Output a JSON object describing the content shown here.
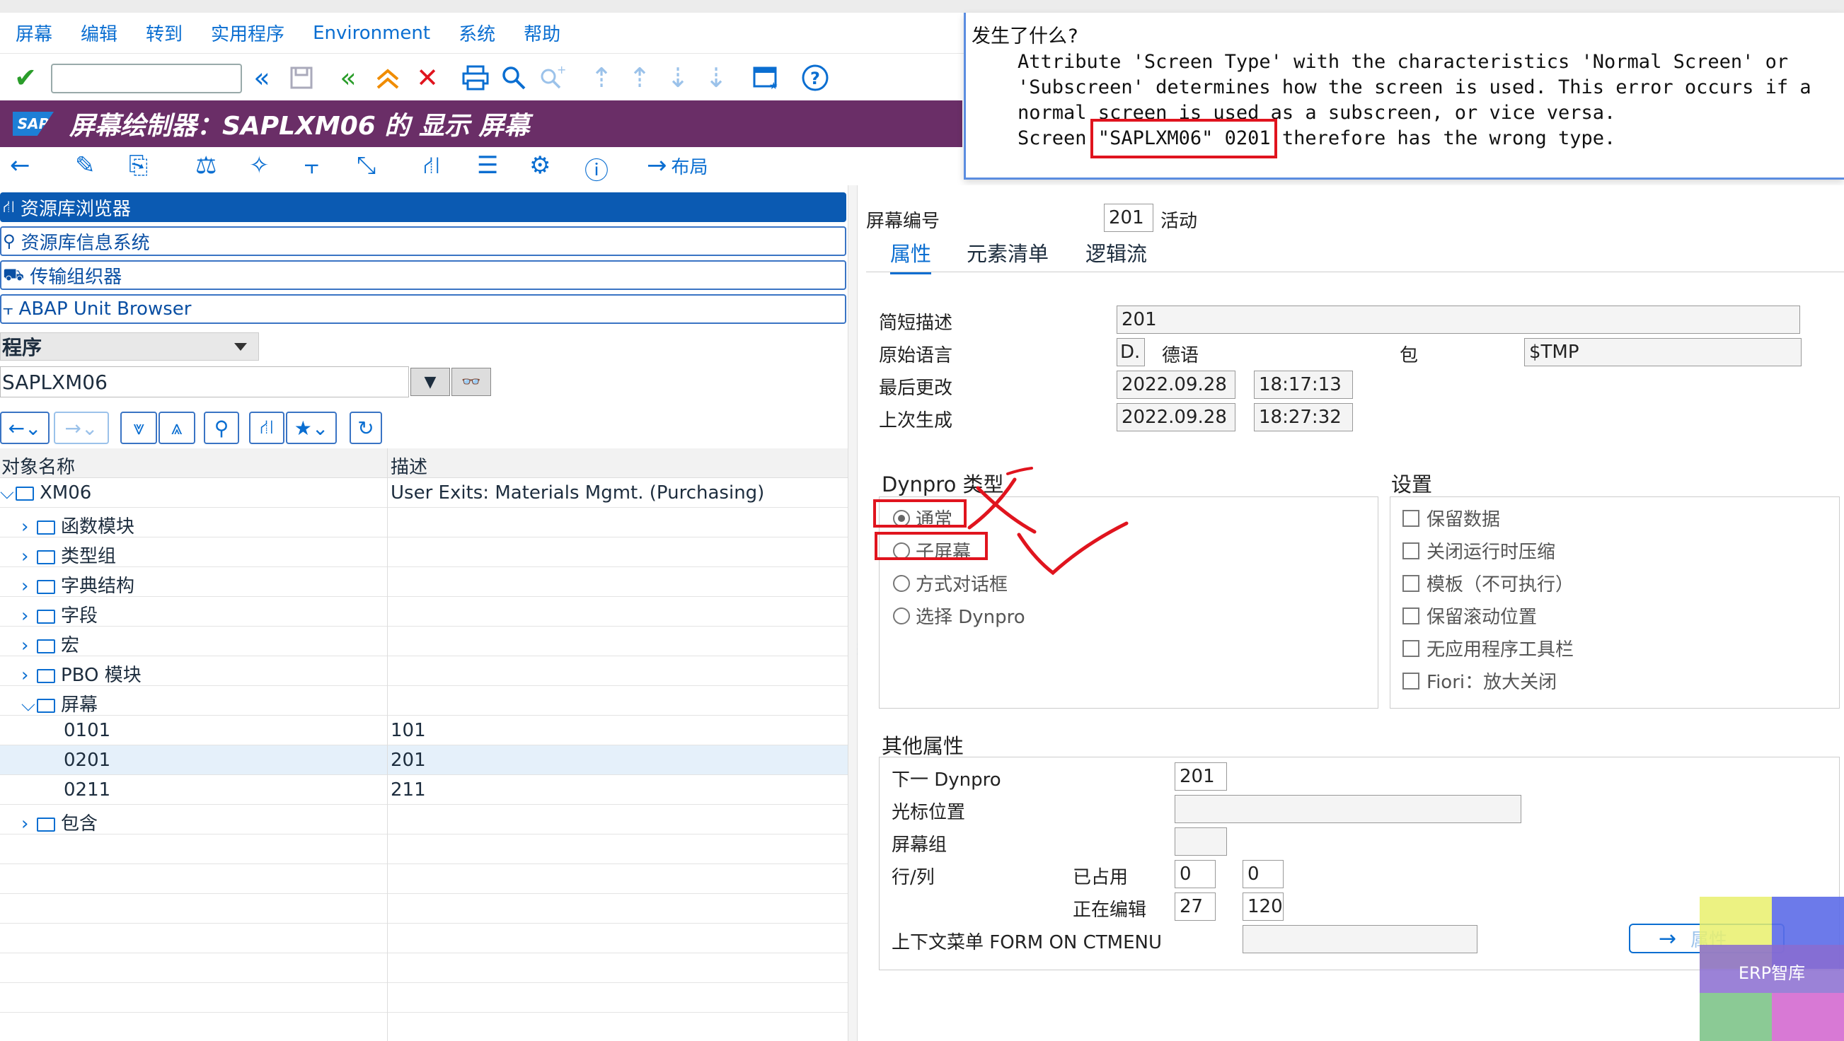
{
  "menu": [
    "屏幕",
    "编辑",
    "转到",
    "实用程序",
    "Environment",
    "系统",
    "帮助"
  ],
  "titlebar": {
    "logo": "SAP",
    "title": "屏幕绘制器：SAPLXM06 的 显示 屏幕"
  },
  "toolbar2": {
    "layout_label": "布局"
  },
  "error": {
    "heading": "发生了什么?",
    "line1": "    Attribute 'Screen Type' with the characteristics 'Normal Screen' or",
    "line2": "    'Subscreen' determines how the screen is used. This error occurs if a",
    "line3": "    normal screen is used as a subscreen, or vice versa.",
    "line4": "    Screen \"SAPLXM06\" 0201 therefore has the wrong type."
  },
  "nav": [
    "资源库浏览器",
    "资源库信息系统",
    "传输组织器",
    "ABAP Unit Browser"
  ],
  "object_type": "程序",
  "program_name": "SAPLXM06",
  "tree": {
    "col1": "对象名称",
    "col2": "描述",
    "root": {
      "name": "XM06",
      "desc": "User Exits: Materials Mgmt. (Purchasing)"
    },
    "nodes": [
      "函数模块",
      "类型组",
      "字典结构",
      "字段",
      "宏",
      "PBO 模块"
    ],
    "screens_label": "屏幕",
    "screens": [
      {
        "name": "0101",
        "desc": "101"
      },
      {
        "name": "0201",
        "desc": "201"
      },
      {
        "name": "0211",
        "desc": "211"
      }
    ],
    "include_label": "包含"
  },
  "screen": {
    "number_label": "屏幕编号",
    "number": "201",
    "status": "活动",
    "tabs": [
      "属性",
      "元素清单",
      "逻辑流"
    ],
    "short_desc_label": "简短描述",
    "short_desc": "201",
    "orig_lang_label": "原始语言",
    "lang_code": "D.",
    "lang_name": "德语",
    "package_label": "包",
    "package": "$TMP",
    "last_change_label": "最后更改",
    "last_change_date": "2022.09.28",
    "last_change_time": "18:17:13",
    "last_gen_label": "上次生成",
    "last_gen_date": "2022.09.28",
    "last_gen_time": "18:27:32",
    "dynpro_type_title": "Dynpro 类型",
    "dynpro_types": [
      "通常",
      "子屏幕",
      "方式对话框",
      "选择 Dynpro"
    ],
    "settings_title": "设置",
    "settings": [
      "保留数据",
      "关闭运行时压缩",
      "模板（不可执行）",
      "保留滚动位置",
      "无应用程序工具栏",
      "Fiori：放大关闭"
    ],
    "other_title": "其他属性",
    "next_dynpro_label": "下一 Dynpro",
    "next_dynpro": "201",
    "cursor_label": "光标位置",
    "screen_group_label": "屏幕组",
    "rowcol_label": "行/列",
    "used_label": "已占用",
    "used_row": "0",
    "used_col": "0",
    "edit_label": "正在编辑",
    "edit_row": "27",
    "edit_col": "120",
    "ctx_menu_label": "上下文菜单 FORM ON CTMENU",
    "attr_button": "属性"
  },
  "watermark": "ERP智库",
  "colors": {
    "title_bg": "#6a2e67",
    "accent": "#0a6ed1",
    "annotation": "#e0141e"
  }
}
